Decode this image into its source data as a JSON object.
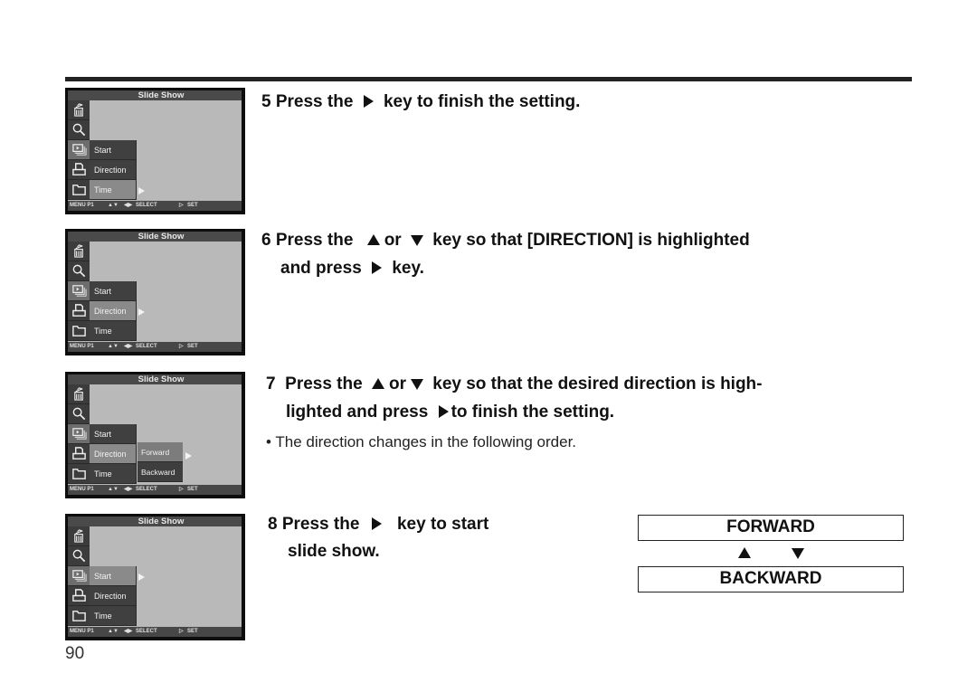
{
  "screen": {
    "title": "Slide Show",
    "menu": [
      "Start",
      "Direction",
      "Time"
    ],
    "submenu": [
      "Forward",
      "Backward"
    ],
    "status": {
      "page": "MENU P1",
      "updown": "▲▼",
      "leftright": "◀▶",
      "select": "SELECT",
      "set_arrow": "▷",
      "set": "SET"
    },
    "icons": [
      "delete-icon",
      "magnify-icon",
      "slideshow-icon",
      "print-icon",
      "folder-icon"
    ]
  },
  "steps": {
    "s5": {
      "num": "5",
      "pre": "Press the",
      "post": "key to finish the setting."
    },
    "s6": {
      "num": "6",
      "pre": "Press the",
      "or": "or",
      "post": "key so that [DIRECTION] is highlighted",
      "line2_pre": "and press",
      "line2_post": "key."
    },
    "s7": {
      "num": "7",
      "pre": "Press the",
      "or": "or",
      "post": "key so that the desired direction is high-",
      "line2_pre": "lighted and press",
      "line2_post": "to finish the setting.",
      "note": "• The direction changes in the following order."
    },
    "s8": {
      "num": "8",
      "pre": "Press the",
      "post": "key to start",
      "line2": "slide show."
    }
  },
  "direction_order": {
    "first": "FORWARD",
    "second": "BACKWARD"
  },
  "page_number": "90"
}
